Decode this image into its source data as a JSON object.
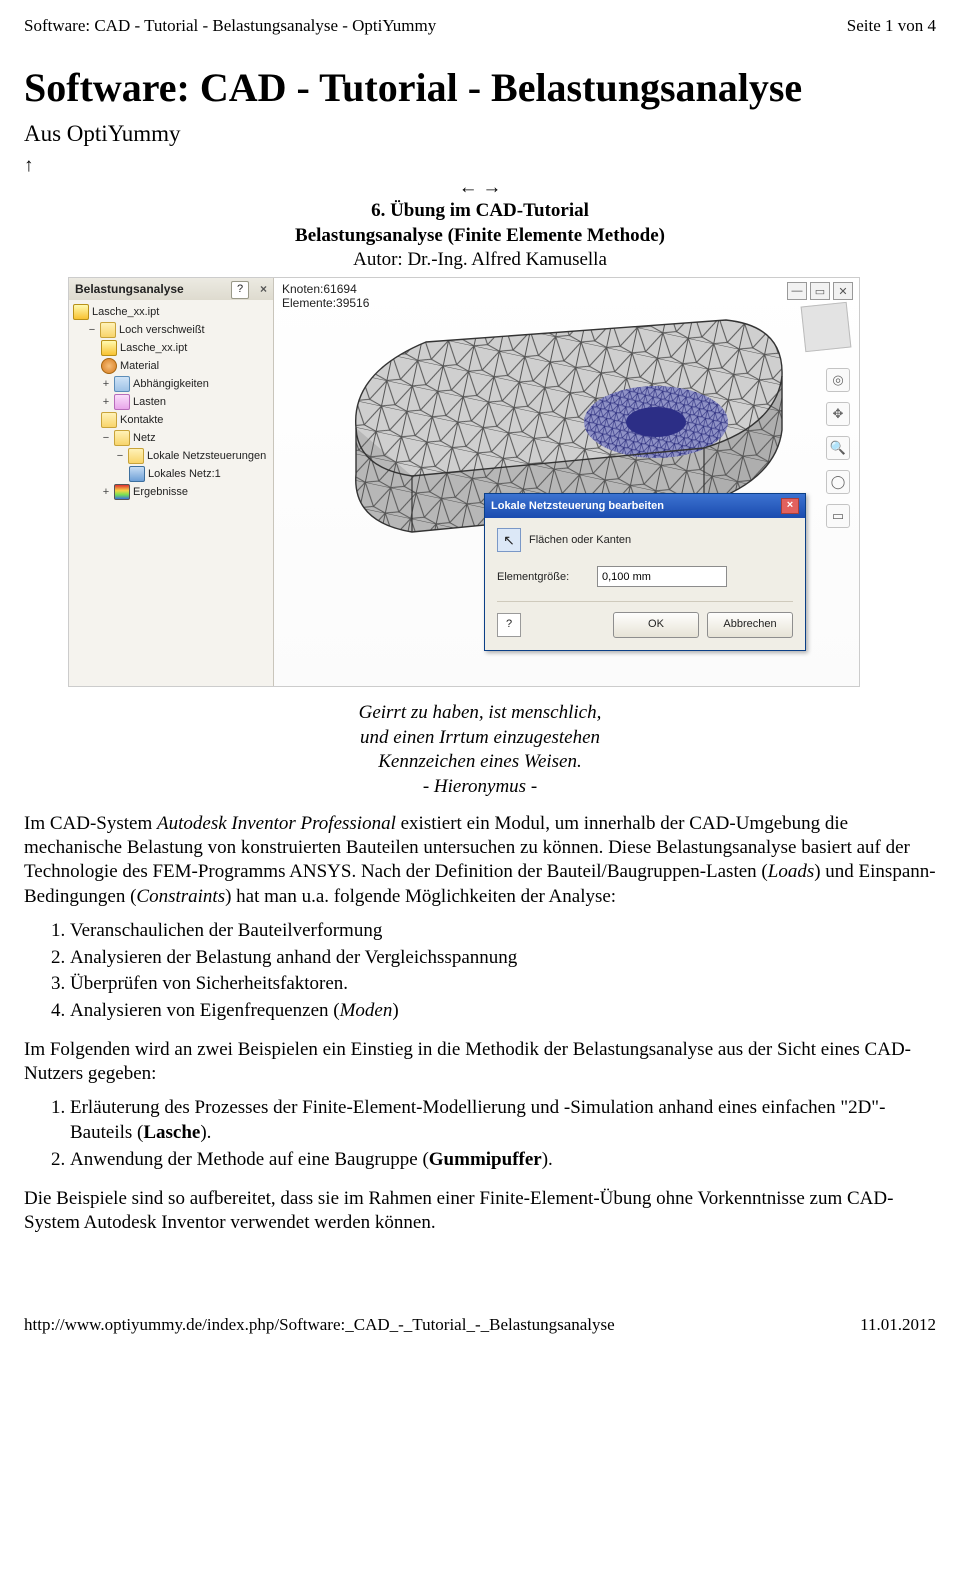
{
  "header": {
    "left": "Software: CAD - Tutorial - Belastungsanalyse - OptiYummy",
    "right": "Seite 1 von 4"
  },
  "title": "Software: CAD - Tutorial - Belastungsanalyse",
  "subtitle": "Aus OptiYummy",
  "nav_up": "↑",
  "nav_lr": "←   →",
  "center": {
    "line1": "6. Übung im CAD-Tutorial",
    "line2": "Belastungsanalyse (Finite Elemente Methode)",
    "line3a": "Autor: ",
    "line3b": "Dr.-Ing. Alfred Kamusella"
  },
  "screenshot": {
    "panel_title": "Belastungsanalyse",
    "close": "×",
    "help": "?",
    "tree": {
      "root": "Lasche_xx.ipt",
      "n1": "Loch verschweißt",
      "n1a": "Lasche_xx.ipt",
      "n1b": "Material",
      "n1c": "Abhängigkeiten",
      "n1d": "Lasten",
      "n1e": "Kontakte",
      "n1f": "Netz",
      "n1f1": "Lokale Netzsteuerungen",
      "n1f1a": "Lokales Netz:1",
      "n1g": "Ergebnisse"
    },
    "info_nodes_label": "Knoten:",
    "info_nodes_value": "61694",
    "info_elems_label": "Elemente:",
    "info_elems_value": "39516",
    "winbtns": {
      "min": "—",
      "max": "▭",
      "close": "✕"
    },
    "dlg": {
      "title": "Lokale Netzsteuerung bearbeiten",
      "close": "×",
      "sel_label": "Flächen oder Kanten",
      "sel_icon": "↖",
      "size_label": "Elementgröße:",
      "size_value": "0,100 mm",
      "help": "?",
      "ok": "OK",
      "cancel": "Abbrechen"
    }
  },
  "quote": {
    "l1": "Geirrt zu haben, ist menschlich,",
    "l2": "und einen Irrtum einzugestehen",
    "l3": "Kennzeichen eines Weisen.",
    "l4": "- Hieronymus -"
  },
  "para1_a": "Im CAD-System ",
  "para1_b": "Autodesk Inventor Professional",
  "para1_c": " existiert ein Modul, um innerhalb der CAD-Umgebung die mechanische Belastung von konstruierten Bauteilen untersuchen zu können. Diese Belastungsanalyse basiert auf der Technologie des FEM-Programms ANSYS. Nach der Definition der Bauteil/Baugruppen-Lasten (",
  "para1_d": "Loads",
  "para1_e": ") und Einspann-Bedingungen (",
  "para1_f": "Constraints",
  "para1_g": ") hat man u.a. folgende Möglichkeiten der Analyse:",
  "listA": {
    "i1": "Veranschaulichen der Bauteilverformung",
    "i2": "Analysieren der Belastung anhand der Vergleichsspannung",
    "i3": "Überprüfen von Sicherheitsfaktoren.",
    "i4a": "Analysieren von Eigenfrequenzen (",
    "i4b": "Moden",
    "i4c": ")"
  },
  "para2": "Im Folgenden wird an zwei Beispielen ein Einstieg in die Methodik der Belastungsanalyse aus der Sicht eines CAD-Nutzers gegeben:",
  "listB": {
    "i1a": "Erläuterung des Prozesses der Finite-Element-Modellierung und -Simulation anhand eines einfachen \"2D\"-Bauteils (",
    "i1b": "Lasche",
    "i1c": ").",
    "i2a": "Anwendung der Methode auf eine Baugruppe (",
    "i2b": "Gummipuffer",
    "i2c": ")."
  },
  "para3": "Die Beispiele sind so aufbereitet, dass sie im Rahmen einer Finite-Element-Übung ohne Vorkenntnisse zum CAD-System Autodesk Inventor verwendet werden können.",
  "footer": {
    "url": "http://www.optiyummy.de/index.php/Software:_CAD_-_Tutorial_-_Belastungsanalyse",
    "date": "11.01.2012"
  }
}
